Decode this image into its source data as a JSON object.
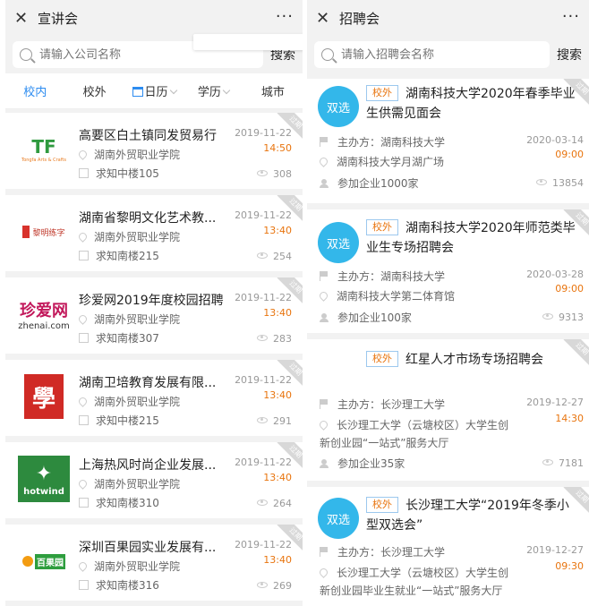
{
  "left": {
    "title": "宣讲会",
    "more": "···",
    "search_placeholder": "请输入公司名称",
    "search_button": "搜索",
    "filters": [
      "校内",
      "校外",
      "日历",
      "学历",
      "城市"
    ],
    "items": [
      {
        "name": "高要区白土镇同发贸易行",
        "date": "2019-11-22",
        "time": "14:50",
        "school": "湖南外贸职业学院",
        "room": "求知中楼105",
        "views": "308",
        "logo_text": "TF",
        "logo_sub": "Tongfa Arts & Crafts"
      },
      {
        "name": "湖南省黎明文化艺术教...",
        "date": "2019-11-22",
        "time": "13:40",
        "school": "湖南外贸职业学院",
        "room": "求知南楼215",
        "views": "254",
        "logo_text": "黎明练字"
      },
      {
        "name": "珍爱网2019年度校园招聘",
        "date": "2019-11-22",
        "time": "13:40",
        "school": "湖南外贸职业学院",
        "room": "求知南楼307",
        "views": "283",
        "logo_text": "珍爱网",
        "logo_sub": "zhenai.com"
      },
      {
        "name": "湖南卫培教育发展有限...",
        "date": "2019-11-22",
        "time": "13:40",
        "school": "湖南外贸职业学院",
        "room": "求知中楼215",
        "views": "291",
        "logo_text": "學"
      },
      {
        "name": "上海热风时尚企业发展...",
        "date": "2019-11-22",
        "time": "13:40",
        "school": "湖南外贸职业学院",
        "room": "求知南楼310",
        "views": "264",
        "logo_text": "hotwind"
      },
      {
        "name": "深圳百果园实业发展有...",
        "date": "2019-11-22",
        "time": "13:40",
        "school": "湖南外贸职业学院",
        "room": "求知南楼316",
        "views": "269",
        "logo_text": "百果园"
      }
    ]
  },
  "right": {
    "title": "招聘会",
    "more": "···",
    "search_placeholder": "请输入招聘会名称",
    "search_button": "搜索",
    "host_prefix": "主办方：",
    "items": [
      {
        "badge": "双选",
        "tag": "校外",
        "title": "湖南科技大学2020年春季毕业生供需见面会",
        "host": "湖南科技大学",
        "date": "2020-03-14",
        "time": "09:00",
        "place": "湖南科技大学月湖广场",
        "companies": "参加企业1000家",
        "views": "13854"
      },
      {
        "badge": "双选",
        "tag": "校外",
        "title": "湖南科技大学2020年师范类毕业生专场招聘会",
        "host": "湖南科技大学",
        "date": "2020-03-28",
        "time": "09:00",
        "place": "湖南科技大学第二体育馆",
        "companies": "参加企业100家",
        "views": "9313"
      },
      {
        "badge": "",
        "tag": "校外",
        "title": "红星人才市场专场招聘会",
        "host": "长沙理工大学",
        "date": "2019-12-27",
        "time": "14:30",
        "place": "长沙理工大学（云塘校区）大学生创新创业园“一站式”服务大厅",
        "companies": "参加企业35家",
        "views": "7181"
      },
      {
        "badge": "双选",
        "tag": "校外",
        "title": "长沙理工大学“2019年冬季小型双选会”",
        "host": "长沙理工大学",
        "date": "2019-12-27",
        "time": "09:30",
        "place": "长沙理工大学（云塘校区）大学生创新创业园毕业生就业“一站式”服务大厅",
        "companies": "",
        "views": ""
      }
    ]
  },
  "ribbon_text": "过期",
  "colors": {
    "accent_blue": "#2d8cf0",
    "time_orange": "#e8740e",
    "badge_blue": "#33b7ea"
  }
}
